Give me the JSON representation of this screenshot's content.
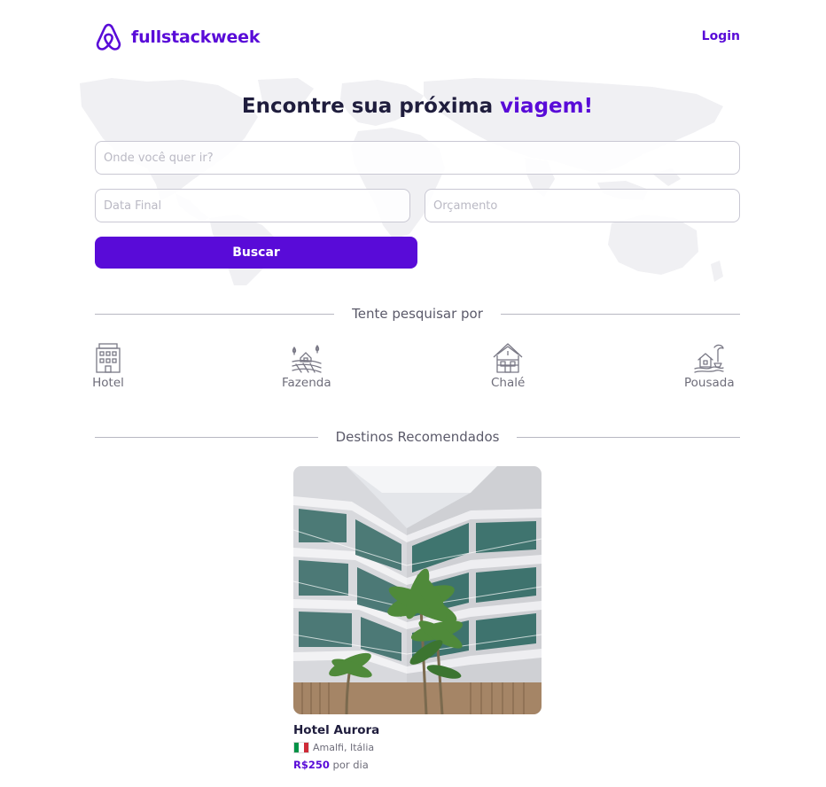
{
  "header": {
    "brand": "fullstackweek",
    "login_label": "Login"
  },
  "hero": {
    "title_prefix": "Encontre sua próxima",
    "title_accent": "viagem!"
  },
  "search": {
    "where_placeholder": "Onde você quer ir?",
    "end_date_placeholder": "Data Final",
    "budget_placeholder": "Orçamento",
    "button_label": "Buscar"
  },
  "quick_search": {
    "title": "Tente pesquisar por",
    "categories": [
      {
        "label": "Hotel",
        "icon": "hotel-icon"
      },
      {
        "label": "Fazenda",
        "icon": "farm-icon"
      },
      {
        "label": "Chalé",
        "icon": "chalet-icon"
      },
      {
        "label": "Pousada",
        "icon": "inn-icon"
      }
    ]
  },
  "recommended": {
    "title": "Destinos Recomendados",
    "trips": [
      {
        "name": "Hotel Aurora",
        "location": "Amalfi, Itália",
        "flag": "italy-flag",
        "price": "R$250",
        "price_suffix": "por dia"
      }
    ]
  },
  "colors": {
    "primary": "#590bd8",
    "dark": "#1f1d3d",
    "gray": "#6e6d7a"
  }
}
